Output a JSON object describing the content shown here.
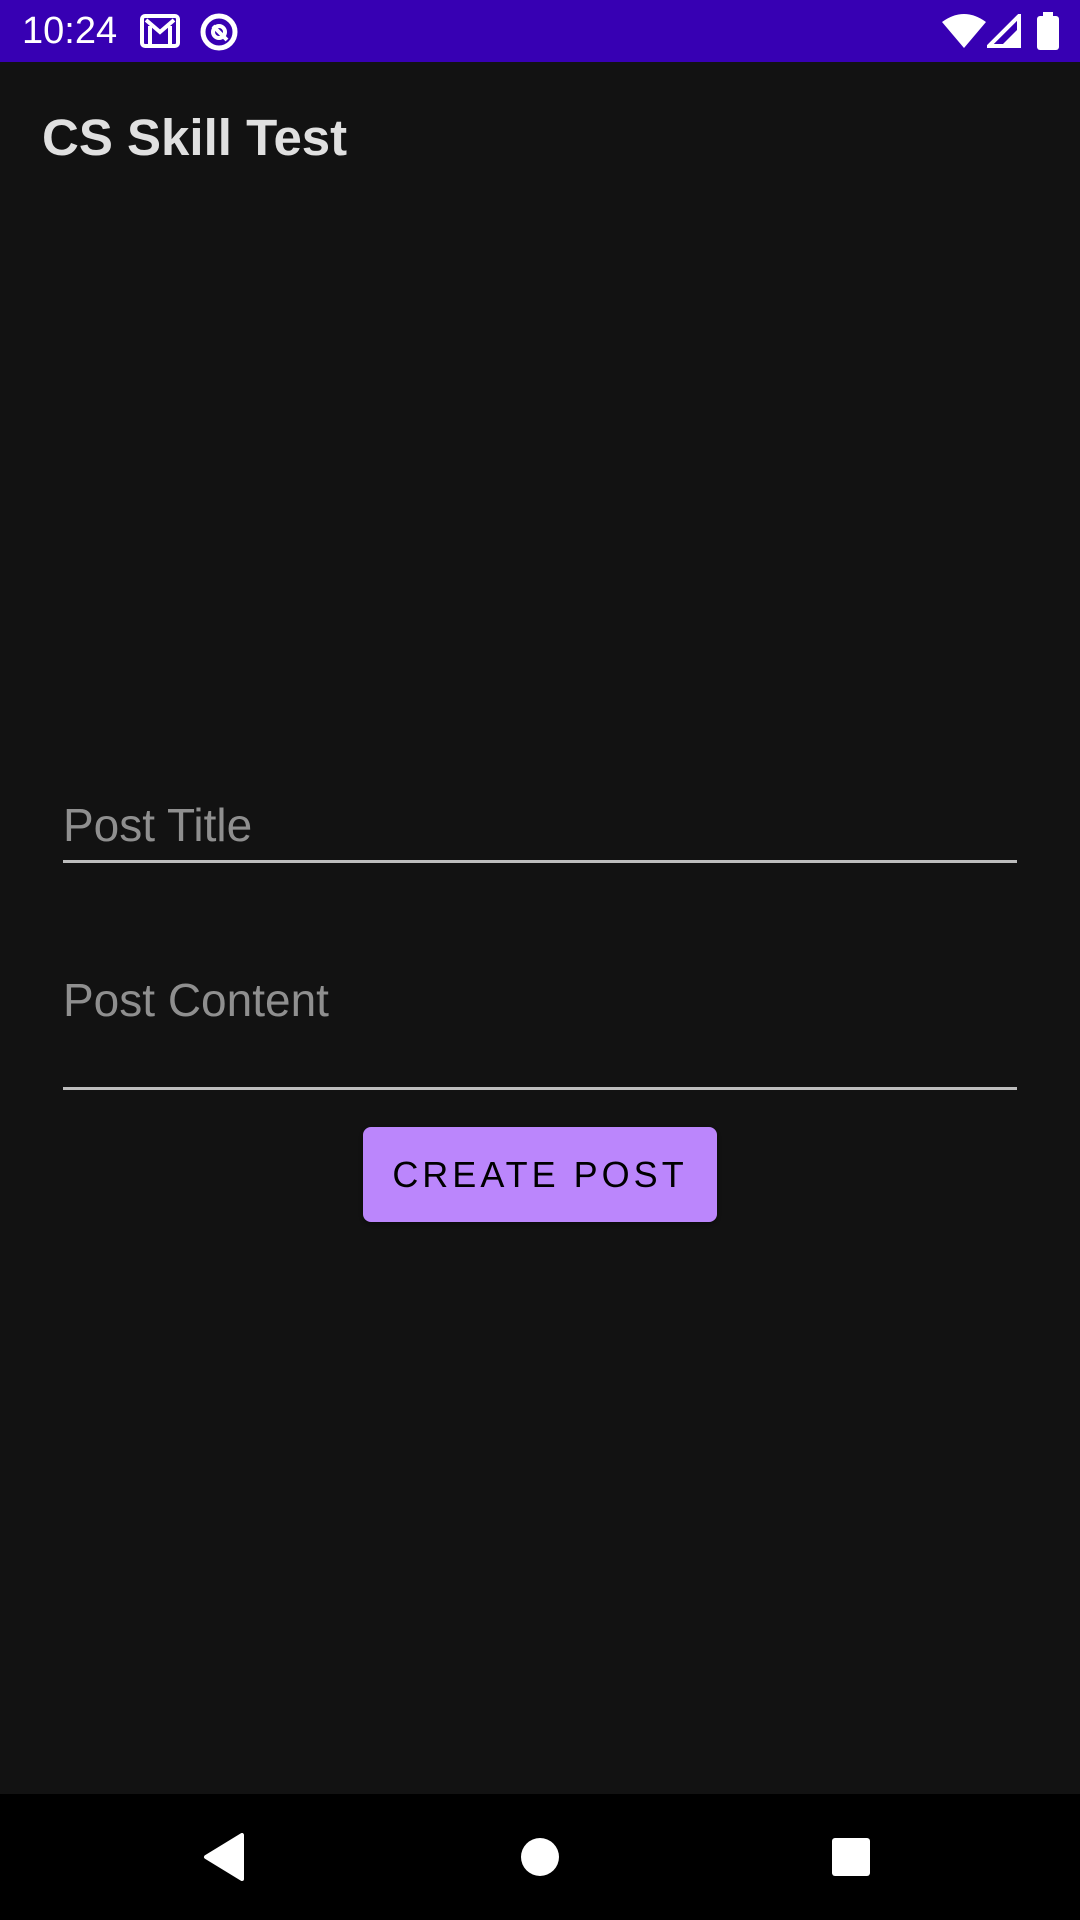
{
  "status_bar": {
    "time": "10:24",
    "background": "#3700b3",
    "left_icons": [
      "gmail-icon",
      "at-sign-icon"
    ],
    "right_icons": [
      "wifi-icon",
      "cell-signal-icon",
      "battery-icon"
    ]
  },
  "app": {
    "title": "CS Skill Test",
    "background": "#121212"
  },
  "form": {
    "title_field": {
      "placeholder": "Post Title",
      "value": ""
    },
    "content_field": {
      "placeholder": "Post Content",
      "value": ""
    },
    "create_button": {
      "label": "CREATE POST",
      "color": "#bb86fc"
    }
  },
  "nav_bar": {
    "buttons": [
      "back-icon",
      "home-icon",
      "recents-icon"
    ]
  }
}
